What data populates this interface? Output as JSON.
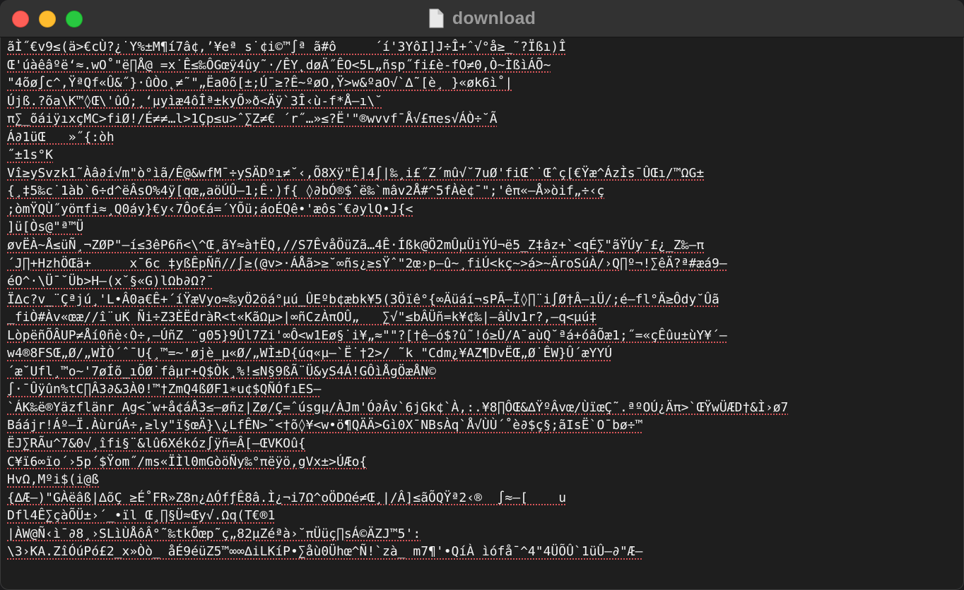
{
  "window": {
    "title": "download",
    "icons": {
      "close": "close-traffic-light",
      "minimize": "minimize-traffic-light",
      "maximize": "maximize-traffic-light",
      "document": "document-icon"
    },
    "colors": {
      "close": "#fe5f57",
      "minimize": "#febc2e",
      "maximize": "#28c840",
      "titlebar": "#323232",
      "background": "#1e1e1e",
      "text": "#f2f2f2",
      "spellcheck_underline": "#d9565a"
    }
  },
  "terminal": {
    "lines": [
      "ãÌ˝€v9≤(ä>€cÙ?¿˙Y%±M¶í7â¢,’¥eª s˙¢i©™∫ª ã#ô     ´í'3YôI]J÷Î+ˆ√°å≥_˜?Ïßı)Î",
      "Œ'úàêâºë‘≈.wO˚\"ë∏Å@ =x˙Ê≤‰ÔGœÿ4ûy˜·/ÊY˛døÄ˝ÊO<5L„ñsp˝fi£è-fO≠0,Ò~ÌßìÁÕ~",
      "\"4õø∫c^,ŸªQf«Û&˝}·ûÒo˛≠˜\"„Ëa0õ[±;Ú¯≥?Ê~ºøO,Ÿ>w&ºaO√`∆˜[è¸ }«øk6ì˚|",
      "Újß.?õa\\K™◊Œ\\'ûÓ;¸‘µyìæ4ôÎª±kyÕ»ð<Äÿ`3Î‹ù-f*Å–ı\\˘",
      "π∑_õáiÿıxçMC>fiØ!/É≠≠…l>1Çp≤u>ˆ∑Z≠€ ´r˝…»≤?Ë'\"®wvvf¯Å√£πes√ÁÒ÷˘Ã",
      "Á∂1üŒ   »˝{:òh",
      "˝±1s°K",
      "Vî≥ySvzk1˜Àâ∂í√m\"ò°ìã/Ê@&wfM¯÷ySÄDºı≠˘‹,Õ8Xÿ\"Ê]4∫|‰¸i£˝Z´mû√˘7uØ'fiŒˆ˙Œˆç[€Ÿæ^ÁzÌs¯ÛŒı/™ΩG±",
      "{¸‡5‰c˙1àb`6÷d^ëÂsO%4ÿ[qœ„aöÚÛ–1;Ê·)f{ ◊∂bÓ®$ˆë‰`mâv2Å#^5fÀè¢¯\";'êπ«–Å»òif„÷‹ç",
      ";òmŸQÙ˝yöπfi≈¸Q0áy}€y‹7Ôo€á=´YÕü;áoÉQê•'æôs˘€∂ylQ•J{<",
      "]ü[Òs@\"ª™Ü",
      "øvËÀ~Å≤üÑ¸¬ZØP\"–í≤3êP6ñ<\\^Œ¸ãY≈à†ËQ,//S7ÊvåÖüZã…4Ê·Íßk@Ö2mÛµÜiŸÚ¬ë5_Z‡âz+`<qÉ∑\"ãŸÚy¯£¿_Z‰–π",
      "´J∏+HzhÖŒä+     x¯6c ‡yßÊpÑñ//∫≥(@v>·ÁÅã>≥˘∞ñs¿≥sŸˆ\"2œ›p–û~¸fiÚ<kç~>á>~ÄroSúÀ/›Q∏º¬!∑êÄ?ª#æá9–",
      "éO^·\\Ü¯˘Üb>H–(x˘§«G)lΩb∂Ω?¯",
      "Ï∆c?v_¨Çªjú¸'L•Â0a€Ê+´íŸæVyo≈‰yÖ2öá°µú_ÛEºb¢æbk¥5(3Öïê°{∞Äüáí¬sPÃ–Ï◊∏¨i∫Ø†Â–ıÜ/;é–fl°Ä≥Ôdy˘Ûã",
      "_fiÒ#Àv«œæ//î¨uK Ñi÷Z3ÈËdràR<t«KãΩµ>|∞ñCzÀπOÛ„   ∑√\"≤bÂÜñ=k¥¢‰|–âÙv1r?,–q<µú‡",
      "LòpëñÕÂUP≠Åí0ñè‹Ò÷,–ÚñZ ¨g05}9Ûl7Zi'∞Ô<w1Eø§˙i¥„≈\"\"?[†ê–ó$?û˜!ó≥Û/A¯aùQ˘ªá+óâÕæ1;˝=«çÊûu±ùY¥´–",
      "w4®8FSŒ„Ø/„WÌÒ´ˆ¯U{¸™=~'øjè_µ«Ø/„WÌ±D{úq«µ–`Ë˙†2>/ ˜k \"Cdm¿¥AZ¶DvËŒ„Ø˙ÊW}Û´æYYÚ",
      "´æ˘Ufl¸™o~'7øÍõ_ıÕØ˙fâµr+Q$Òk¸%!≤N§9ßÃ¨Ü&yS4Á!GÔìÅgÖæÅN©",
      "∫·¯Ûÿûn%tC∏Â3∂&3À0!™†ZmQ4ßØF1∗u¢$QÑÓfıES–",
      "`ÁK‰ë®Yäzflänr Ag<˘w+å¢áÅ3≤–øñz|Zø/Ç=ˆúsgµ/ÀJm'Ó∂Âv`6jGk¢`À,:.¥8∏ÔŒ&∆ŸºÂvœ/ÙïœÇ˜.ªºOÚ¿Äπ>`ŒŸwÜÆD†&Ì›ø7",
      "Báájr!Áº–Ï.ÀùrúÁ÷,≥ly\"ï§œÄ}\\¿LfÊN>˜<†õ◊¥<w•ö¶QÄÄ>Gì0X¯NBsÀq`Å√ÙÙ´˚è∂$ç§;ãIsË`O¯bø÷™",
      "ËJ∑RÃu^7&0√¸îfi§¨&lû6Xékóz∫ÿñ=Â[–ŒVKOû{",
      "C¥ï6∞ïo´›5p´$Ÿom˝/ms«ÏÌl0mGòöÑy‰°πëÿö,gVx±>ÚÆo{",
      "HvΩ,Mºi$(i@ß",
      "{∆Æ–)\"GÀëâß|∆õÇ ≥É˚FR»Z8n¿∆ÓfƒÊ8â.Ì¿¬i7Ω^oÖDΩé≠Œ¸|/Â]≤ãÕQŸª2‹®  ∫≈–[    u",
      "Dfl4Ê∑çàÕÜ±›´_•ïl Œ¸∏§Ü≈Œy√.Ωq(T€®1",
      "|ÀW@Ñ‹ì¯∂8¸›SLìÙÅôÂ°˜‰tkÕœp˜ç„82µZéªà›˘πÜüç∏sÁ©ÄZJ™5':",
      "\\3›KA.ZîÓúPó£2_x»Òò_ åÉ9éüZ5™∞∞∆iLKíP•∑åù0Ühœ^Ñ!`zà_ m7¶'•QíÀ ìófå¯^4\"4ÜÕÛ`1üÛ–∂\"Æ–"
    ]
  }
}
